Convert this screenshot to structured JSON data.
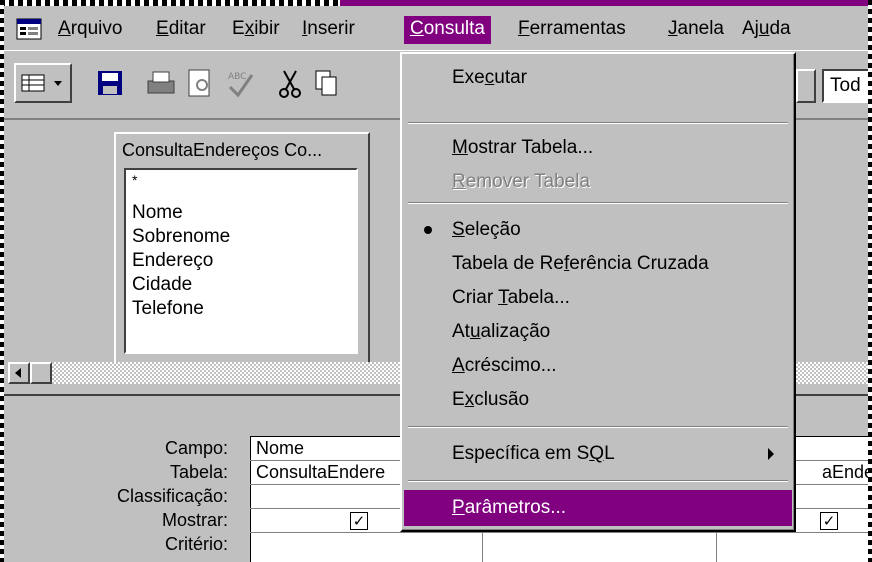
{
  "menubar": {
    "items": [
      {
        "label": "Arquivo"
      },
      {
        "label": "Editar"
      },
      {
        "label": "Exibir"
      },
      {
        "label": "Inserir"
      },
      {
        "label": "Consulta",
        "active": true
      },
      {
        "label": "Ferramentas"
      },
      {
        "label": "Janela"
      },
      {
        "label": "Ajuda"
      }
    ]
  },
  "toolbar": {
    "combo_value": "Tod"
  },
  "table_box": {
    "title": "ConsultaEndereços Co...",
    "fields": [
      "*",
      "Nome",
      "Sobrenome",
      "Endereço",
      "Cidade",
      "Telefone"
    ]
  },
  "grid": {
    "row_labels": [
      "Campo:",
      "Tabela:",
      "Classificação:",
      "Mostrar:",
      "Critério:"
    ],
    "col1_field": "Nome",
    "col1_table": "ConsultaEndere",
    "col3_table": "aEndere",
    "show_checks": [
      true,
      true,
      true
    ]
  },
  "consulta_menu": {
    "items": [
      {
        "label": "Executar"
      },
      {
        "label": "Mostrar Tabela..."
      },
      {
        "label": "Remover Tabela",
        "disabled": true
      },
      {
        "label": "Seleção",
        "bullet": true
      },
      {
        "label": "Tabela de Referência Cruzada"
      },
      {
        "label": "Criar Tabela..."
      },
      {
        "label": "Atualização"
      },
      {
        "label": "Acréscimo..."
      },
      {
        "label": "Exclusão"
      },
      {
        "label": "Específica em SQL",
        "submenu": true
      },
      {
        "label": "Parâmetros...",
        "highlighted": true
      }
    ]
  },
  "colors": {
    "menu_highlight": "#800080",
    "face": "#c0c0c0"
  }
}
